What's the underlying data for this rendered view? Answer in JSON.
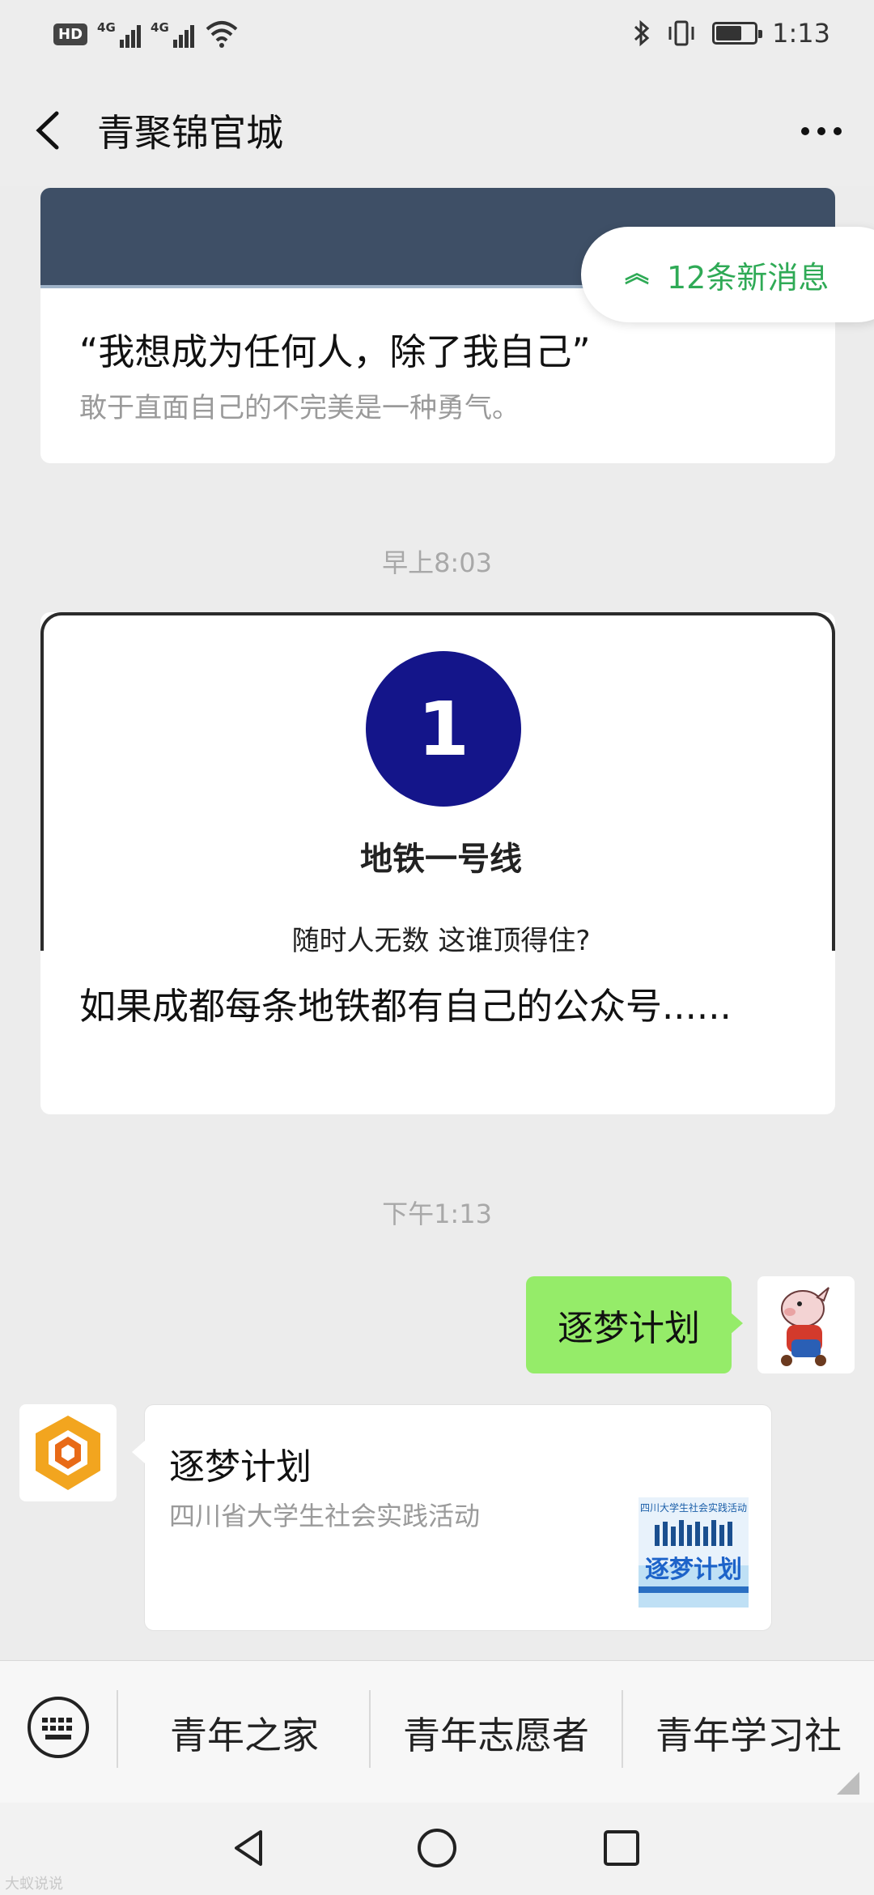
{
  "status_bar": {
    "hd": "HD",
    "net1": "4G",
    "net2": "4G",
    "time": "1:13",
    "battery_level": 0.68
  },
  "header": {
    "title": "青聚锦官城"
  },
  "messages": {
    "article1": {
      "headline": "“我想成为任何人，除了我自己”",
      "digest": "敢于直面自己的不完美是一种勇气。"
    },
    "new_messages_pill": "12条新消息",
    "timestamp1": "早上8:03",
    "article2": {
      "cover_number": "1",
      "cover_line_name": "地铁一号线",
      "cover_subtitle": "随时人无数 这谁顶得住?",
      "headline": "如果成都每条地铁都有自己的公众号......"
    },
    "timestamp2": "下午1:13",
    "outgoing_text": "逐梦计划",
    "incoming_card": {
      "title": "逐梦计划",
      "description": "四川省大学生社会实践活动",
      "thumb_caption": "四川大学生社会实践活动",
      "thumb_title": "逐梦计划"
    }
  },
  "bottom_menu": {
    "items": [
      "青年之家",
      "青年志愿者",
      "青年学习社"
    ]
  },
  "watermark": "大蚁说说",
  "colors": {
    "accent_green": "#2faa56",
    "bubble_green": "#95ec69",
    "cover_dark": "#3e4f66",
    "metro_blue": "#14158a"
  },
  "icons": {
    "back": "chevron-left-icon",
    "more": "more-dots-icon",
    "keyboard": "keyboard-icon",
    "nav_back": "triangle-back-icon",
    "nav_home": "circle-home-icon",
    "nav_recent": "square-recent-icon"
  }
}
